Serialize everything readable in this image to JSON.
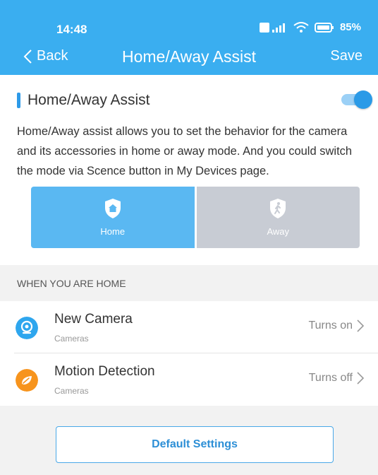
{
  "status_bar": {
    "time": "14:48",
    "battery": "85%"
  },
  "nav": {
    "back_label": "Back",
    "title": "Home/Away Assist",
    "save_label": "Save"
  },
  "section": {
    "title": "Home/Away Assist",
    "toggle_on": true,
    "description": "Home/Away assist allows you to set the behavior for the camera and its accessories in home or away mode. And you could switch the mode via Scence button in My Devices page."
  },
  "modes": [
    {
      "label": "Home",
      "icon": "home-shield-icon",
      "selected": true
    },
    {
      "label": "Away",
      "icon": "walking-person-shield-icon",
      "selected": false
    }
  ],
  "list": {
    "header": "WHEN YOU ARE HOME",
    "items": [
      {
        "name": "New Camera",
        "category": "Cameras",
        "status": "Turns on",
        "icon": "camera-icon",
        "color": "#2ea6ee"
      },
      {
        "name": "Motion Detection",
        "category": "Cameras",
        "status": "Turns off",
        "icon": "motion-detection-icon",
        "color": "#f7941d"
      }
    ]
  },
  "footer": {
    "default_button": "Default Settings"
  },
  "colors": {
    "primary": "#3aaef0",
    "home_mode": "#5ab8f2",
    "away_mode": "#c8ccd4"
  }
}
